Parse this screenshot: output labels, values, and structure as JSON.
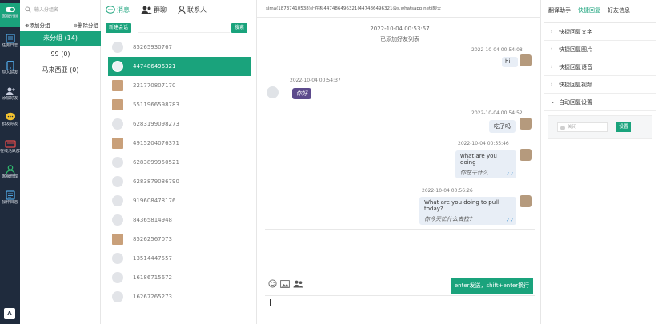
{
  "rail": {
    "items": [
      {
        "label": "客服分组",
        "icon": "toggle-icon",
        "active": true
      },
      {
        "label": "任务日志",
        "icon": "document-icon"
      },
      {
        "label": "导入好友",
        "icon": "phone-icon"
      },
      {
        "label": "添加好友",
        "icon": "add-user-icon"
      },
      {
        "label": "群发好友",
        "icon": "chat-bubble-icon"
      },
      {
        "label": "在线活跃群",
        "icon": "group-icon"
      },
      {
        "label": "客服管理",
        "icon": "user-icon"
      },
      {
        "label": "操作日志",
        "icon": "log-icon"
      }
    ],
    "bottom_icon": "translate-icon",
    "bottom_label": "A"
  },
  "groups": {
    "search_placeholder": "输入分组名",
    "add_label": "添加分组",
    "delete_label": "删除分组",
    "items": [
      {
        "label": "未分组 (14)",
        "active": true
      },
      {
        "label": "99 (0)"
      },
      {
        "label": "马来西亚 (0)"
      }
    ]
  },
  "contacts": {
    "tabs": [
      {
        "label": "消息",
        "icon": "message-icon",
        "active": true
      },
      {
        "label": "群聊",
        "icon": "group-icon"
      },
      {
        "label": "联系人",
        "icon": "contact-icon"
      }
    ],
    "new_chat_label": "新建会话",
    "search_label": "搜索",
    "list": [
      {
        "number": "85265930767",
        "avatar": "default"
      },
      {
        "number": "447486496321",
        "avatar": "default",
        "active": true
      },
      {
        "number": "221770807170",
        "avatar": "photo"
      },
      {
        "number": "5511966598783",
        "avatar": "photo"
      },
      {
        "number": "6283199098273",
        "avatar": "default"
      },
      {
        "number": "4915204076371",
        "avatar": "photo"
      },
      {
        "number": "6283899950521",
        "avatar": "default"
      },
      {
        "number": "6283879086790",
        "avatar": "default"
      },
      {
        "number": "919608478176",
        "avatar": "default"
      },
      {
        "number": "84365814948",
        "avatar": "default"
      },
      {
        "number": "85262567073",
        "avatar": "photo"
      },
      {
        "number": "13514447557",
        "avatar": "default"
      },
      {
        "number": "16186715672",
        "avatar": "default"
      },
      {
        "number": "16267265273",
        "avatar": "default"
      }
    ]
  },
  "chat": {
    "header": "sima(18737410538)正在和447486496321(447486496321@s.whatsapp.net)聊天",
    "system_time": "2022-10-04 00:53:57",
    "system_note": "已添加好友列表",
    "messages": [
      {
        "side": "right",
        "time": "2022-10-04 00:54:08",
        "text": "hi"
      },
      {
        "side": "left",
        "time": "2022-10-04 00:54:37",
        "text": "你好"
      },
      {
        "side": "right",
        "time": "2022-10-04 00:54:52",
        "text": "吃了吗"
      },
      {
        "side": "right",
        "time": "2022-10-04 00:55:46",
        "text": "what are you doing",
        "translation": "你在干什么"
      },
      {
        "side": "right",
        "time": "2022-10-04 00:56:26",
        "text": "What are you doing to pull today?",
        "translation": "你今天忙什么去拉？"
      }
    ],
    "send_label": "enter发送，shift+enter换行"
  },
  "right": {
    "tabs": [
      {
        "label": "翻译助手"
      },
      {
        "label": "快捷回复",
        "active": true
      },
      {
        "label": "好友信息"
      }
    ],
    "items": [
      {
        "label": "快捷回复文字",
        "chevron": "›"
      },
      {
        "label": "快捷回复图片",
        "chevron": "›"
      },
      {
        "label": "快捷回复语音",
        "chevron": "›"
      },
      {
        "label": "快捷回复视频",
        "chevron": "›"
      },
      {
        "label": "自动回复设置",
        "chevron": "⌄"
      }
    ],
    "auto_reply_select": "关闭",
    "set_label": "设置"
  },
  "colors": {
    "accent": "#1aa37c",
    "rail": "#1f2b3d",
    "bubble": "#e8eef6",
    "incoming": "#5c4a8c"
  }
}
